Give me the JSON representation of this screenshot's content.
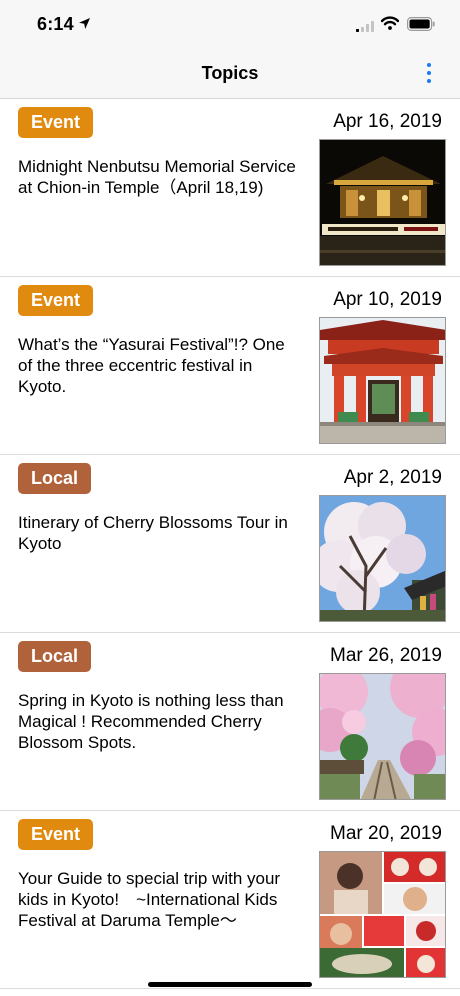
{
  "status_bar": {
    "time": "6:14"
  },
  "nav": {
    "title": "Topics"
  },
  "topics": [
    {
      "category": "Event",
      "date": "Apr 16, 2019",
      "title": "Midnight Nenbutsu Memorial Service at Chion-in Temple（April 18,19)"
    },
    {
      "category": "Event",
      "date": "Apr 10, 2019",
      "title": "What’s the “Yasurai Festival”!? One of the three eccentric festival in Kyoto."
    },
    {
      "category": "Local",
      "date": "Apr 2, 2019",
      "title": "Itinerary of Cherry Blossoms Tour in Kyoto"
    },
    {
      "category": "Local",
      "date": "Mar 26, 2019",
      "title": "Spring in Kyoto is nothing less than Magical ! Recommended Cherry Blossom Spots."
    },
    {
      "category": "Event",
      "date": "Mar 20, 2019",
      "title": "Your Guide to special trip with your kids in Kyoto!　~International Kids Festival at Daruma Temple～"
    }
  ],
  "colors": {
    "event_badge": "#e08b0f",
    "local_badge": "#b0633b",
    "accent": "#1a7cf0"
  },
  "icons": [
    "location-arrow-icon",
    "signal-icon",
    "wifi-icon",
    "battery-icon",
    "more-vertical-icon"
  ]
}
